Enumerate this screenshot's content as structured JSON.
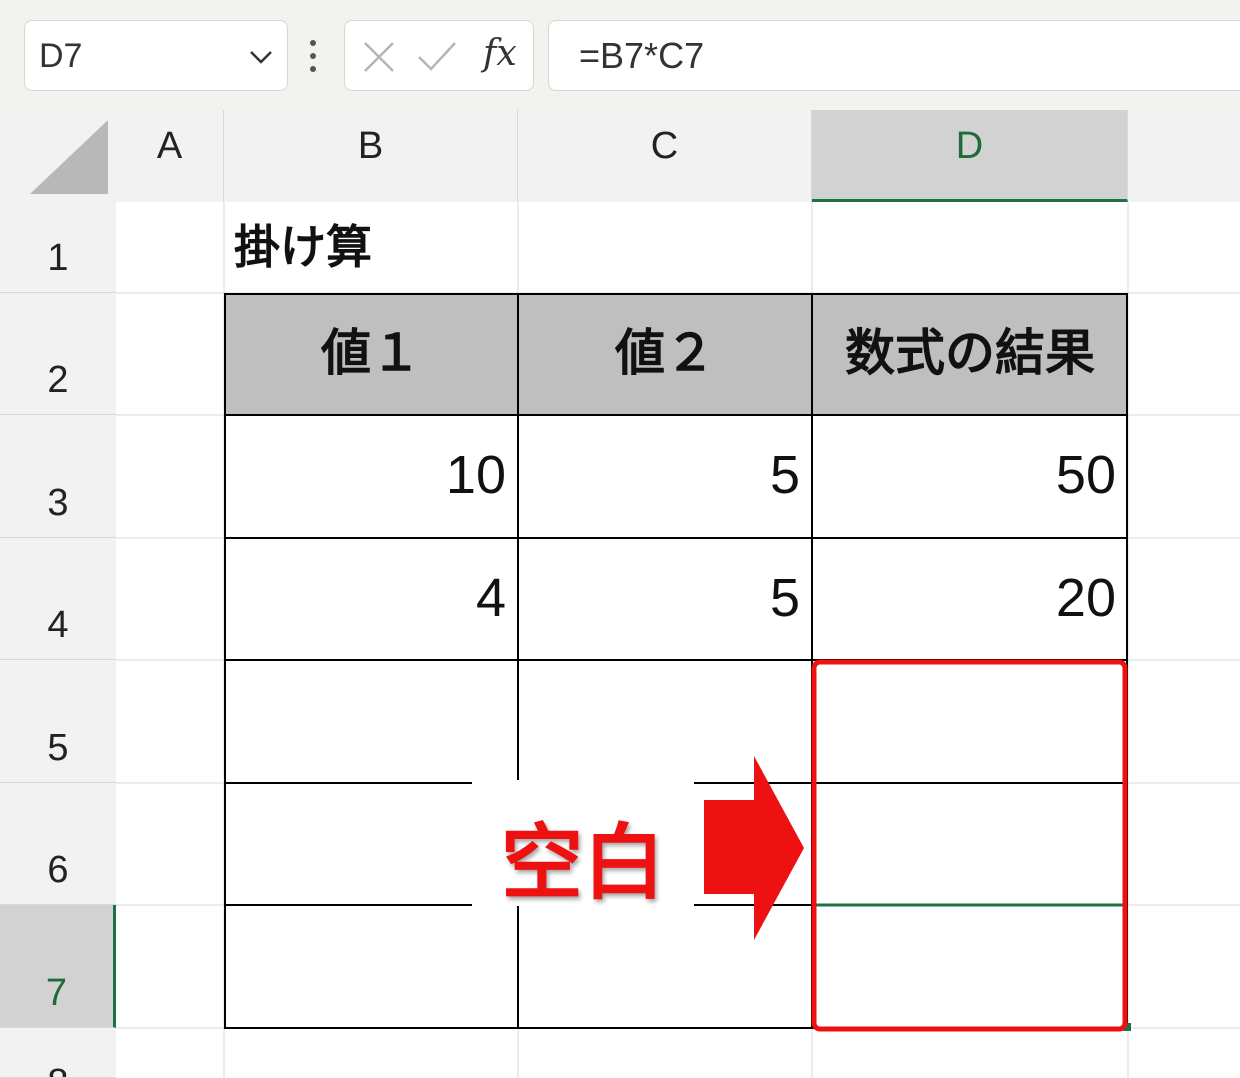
{
  "formula_bar": {
    "name_box": "D7",
    "fx_label": "fx",
    "formula": "=B7*C7"
  },
  "columns": [
    "A",
    "B",
    "C",
    "D"
  ],
  "selected_column": "D",
  "rows": [
    "1",
    "2",
    "3",
    "4",
    "5",
    "6",
    "7",
    "8"
  ],
  "selected_row": "7",
  "sheet": {
    "title": "掛け算",
    "headers": [
      "値１",
      "値２",
      "数式の結果"
    ],
    "data": [
      {
        "b": "10",
        "c": "5",
        "d": "50"
      },
      {
        "b": "4",
        "c": "5",
        "d": "20"
      },
      {
        "b": "",
        "c": "",
        "d": ""
      },
      {
        "b": "",
        "c": "",
        "d": ""
      },
      {
        "b": "",
        "c": "",
        "d": ""
      }
    ]
  },
  "annotation": {
    "label": "空白",
    "color": "#ee1111"
  },
  "colors": {
    "header_fill": "#bfbfbf",
    "selection_green": "#1e7145",
    "annotation_red": "#ee1111"
  }
}
